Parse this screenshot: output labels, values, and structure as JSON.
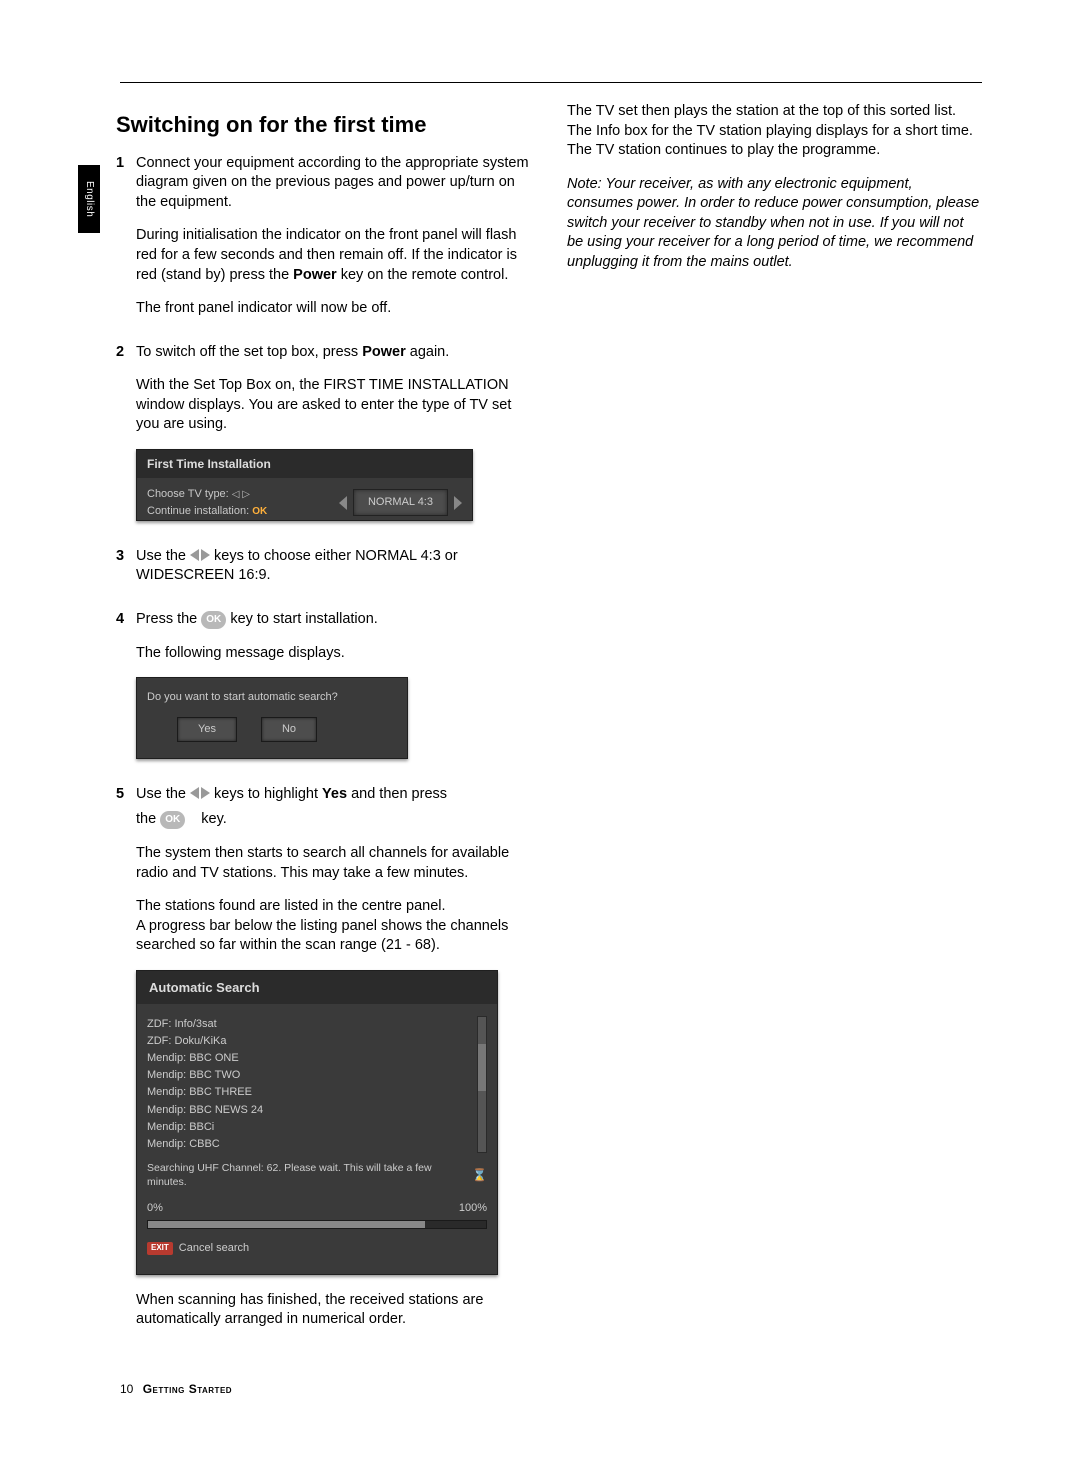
{
  "language_tab": "English",
  "title": "Switching on for the first time",
  "steps": {
    "s1": {
      "num": "1",
      "p1": "Connect your equipment according to the appropriate system diagram given on the previous pages and power up/turn on the equipment.",
      "p2a": "During initialisation the indicator on the front panel will flash red for a few seconds and then remain off. If the indicator is red (stand by) press the ",
      "p2b_bold": "Power",
      "p2c": " key on the remote control.",
      "p3": "The front panel indicator will now be off."
    },
    "s2": {
      "num": "2",
      "p1a": "To switch off the set top box, press ",
      "p1b_bold": "Power",
      "p1c": " again.",
      "p2": "With the Set Top Box on, the FIRST TIME INSTALLATION window displays. You are asked to enter the type of TV set you are using."
    },
    "s3": {
      "num": "3",
      "p1a": "Use the ",
      "p1b": " keys to choose either NORMAL 4:3 or WIDESCREEN 16:9."
    },
    "s4": {
      "num": "4",
      "p1a": "Press the ",
      "p1b": " key to start installation.",
      "p2": "The following message displays."
    },
    "s5": {
      "num": "5",
      "p1a": "Use the ",
      "p1b": " keys to highlight ",
      "p1c_bold": "Yes",
      "p1d": " and then press",
      "p2a": "the ",
      "p2b": " key.",
      "p3": "The system then starts to search all channels for available radio and TV stations. This may take a few minutes.",
      "p4": "The stations found are listed in the centre panel.\nA progress bar below the listing panel  shows the channels searched  so far within the scan range (21 - 68).",
      "p5": "When scanning has finished, the received stations are automatically arranged in numerical order."
    }
  },
  "right_col": {
    "p1": "The TV set then plays the station at the top of this sorted list. The Info box for the TV station playing displays for a short time. The TV station continues to play the programme.",
    "note": "Note:  Your receiver, as with any electronic equipment, consumes power. In order to reduce power consumption, please switch your receiver to standby when not in use. If you will not be using your receiver for a long period of time, we recommend unplugging it from the mains outlet."
  },
  "fti": {
    "title": "First Time Installation",
    "line1": "Choose TV type:",
    "arrows": "◁ ▷",
    "line2": "Continue installation:",
    "ok": "OK",
    "value": "NORMAL 4:3"
  },
  "asp": {
    "question": "Do you want to start automatic search?",
    "yes": "Yes",
    "no": "No"
  },
  "as": {
    "title": "Automatic Search",
    "items": [
      "ZDF: Info/3sat",
      "ZDF: Doku/KiKa",
      "Mendip: BBC ONE",
      "Mendip: BBC TWO",
      "Mendip: BBC THREE",
      "Mendip: BBC NEWS 24",
      "Mendip: BBCi",
      "Mendip: CBBC"
    ],
    "status": "Searching UHF Channel: 62. Please wait. This will take a few minutes.",
    "p0": "0%",
    "p100": "100%",
    "exit": "EXIT",
    "cancel": "Cancel search"
  },
  "ok_label": "OK",
  "footer": {
    "page": "10",
    "section": "Getting Started"
  }
}
